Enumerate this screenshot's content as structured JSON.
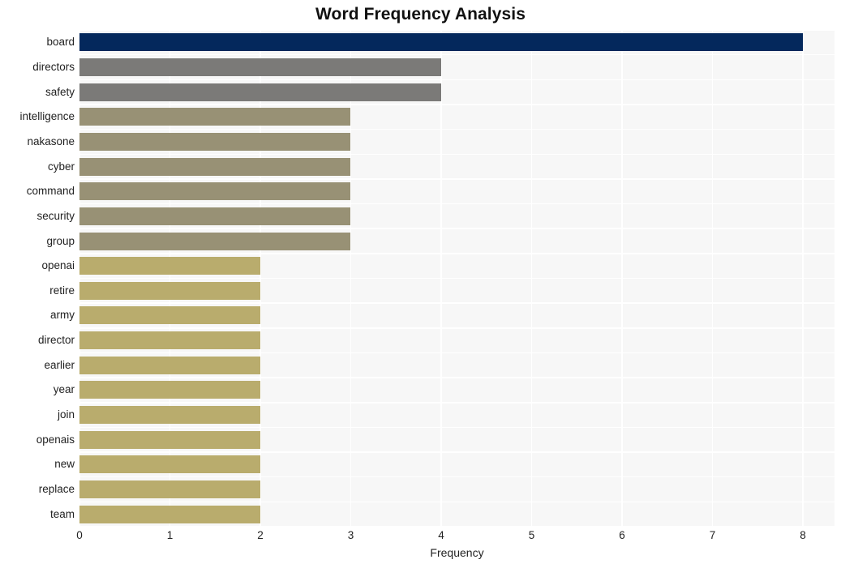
{
  "chart_data": {
    "type": "bar",
    "orientation": "horizontal",
    "title": "Word Frequency Analysis",
    "xlabel": "Frequency",
    "ylabel": "",
    "xlim": [
      0,
      8.35
    ],
    "ylim": [
      0,
      20
    ],
    "grid": true,
    "legend": null,
    "xticks": [
      "0",
      "1",
      "2",
      "3",
      "4",
      "5",
      "6",
      "7",
      "8"
    ],
    "xtick_values": [
      0,
      1,
      2,
      3,
      4,
      5,
      6,
      7,
      8
    ],
    "categories": [
      "board",
      "directors",
      "safety",
      "intelligence",
      "nakasone",
      "cyber",
      "command",
      "security",
      "group",
      "openai",
      "retire",
      "army",
      "director",
      "earlier",
      "year",
      "join",
      "openais",
      "new",
      "replace",
      "team"
    ],
    "values": [
      8,
      4,
      4,
      3,
      3,
      3,
      3,
      3,
      3,
      2,
      2,
      2,
      2,
      2,
      2,
      2,
      2,
      2,
      2,
      2
    ],
    "bar_colors": [
      "#04285c",
      "#7b7a78",
      "#7b7a78",
      "#989175",
      "#989175",
      "#989175",
      "#989175",
      "#989175",
      "#989175",
      "#b9ac6d",
      "#b9ac6d",
      "#b9ac6d",
      "#b9ac6d",
      "#b9ac6d",
      "#b9ac6d",
      "#b9ac6d",
      "#b9ac6d",
      "#b9ac6d",
      "#b9ac6d",
      "#b9ac6d"
    ],
    "plot_background": "#f7f7f7",
    "grid_color": "#ffffff",
    "figure_background": "#ffffff"
  }
}
